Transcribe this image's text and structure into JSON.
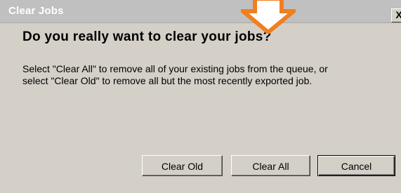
{
  "window": {
    "title": "Clear Jobs",
    "close_label": "X"
  },
  "dialog": {
    "heading": "Do you really want to clear your jobs?",
    "message_lines": [
      "Select \"Clear All\" to remove all of your existing jobs from the queue, or",
      "select \"Clear Old\" to remove all but the most recently exported job."
    ]
  },
  "buttons": {
    "clear_old": "Clear Old",
    "clear_all": "Clear All",
    "cancel": "Cancel"
  },
  "annotation": {
    "arrow_color": "#f07f20",
    "icon": "down-arrow-icon"
  },
  "colors": {
    "dialog_background": "#d4d0c8",
    "titlebar_background": "#c0c0c0"
  }
}
